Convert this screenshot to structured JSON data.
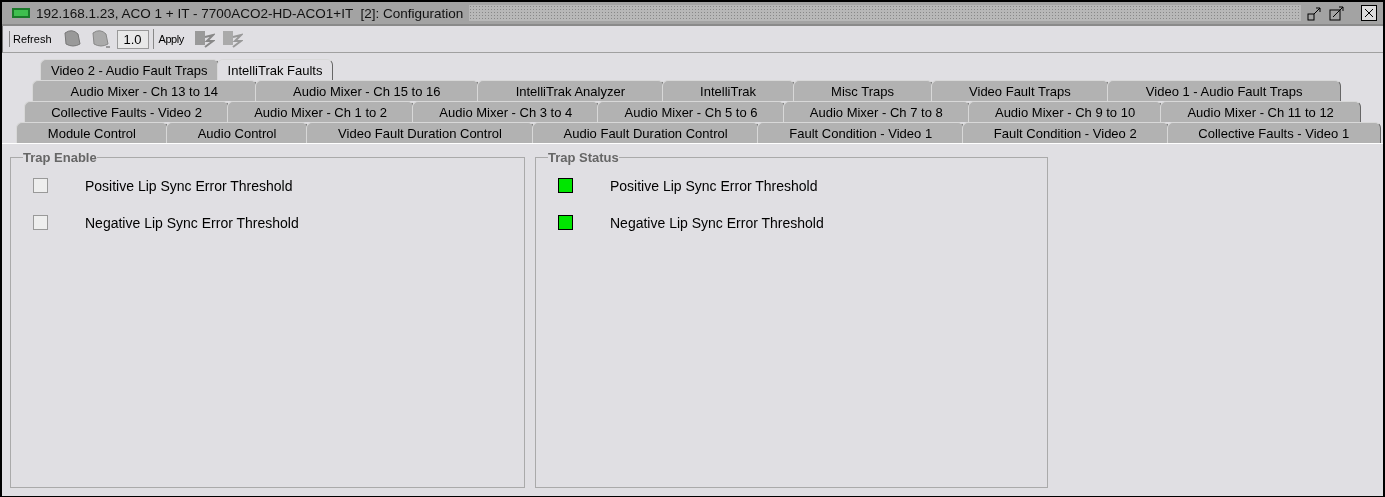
{
  "window": {
    "title": "192.168.1.23, ACO 1 + IT - 7700ACO2-HD-ACO1+IT  [2]: Configuration"
  },
  "toolbar": {
    "refresh": "Refresh",
    "value": "1.0",
    "apply": "Apply"
  },
  "tab_rows": [
    [
      {
        "label": "Video 2 - Audio Fault Traps",
        "selected": false
      },
      {
        "label": "IntelliTrak Faults",
        "selected": true
      }
    ],
    [
      {
        "label": "Audio Mixer - Ch 13 to 14",
        "selected": false
      },
      {
        "label": "Audio Mixer - Ch 15 to 16",
        "selected": false
      },
      {
        "label": "IntelliTrak Analyzer",
        "selected": false
      },
      {
        "label": "IntelliTrak",
        "selected": false
      },
      {
        "label": "Misc Traps",
        "selected": false
      },
      {
        "label": "Video Fault Traps",
        "selected": false
      },
      {
        "label": "Video 1 - Audio Fault Traps",
        "selected": false
      }
    ],
    [
      {
        "label": "Collective Faults - Video 2",
        "selected": false
      },
      {
        "label": "Audio Mixer - Ch 1 to 2",
        "selected": false
      },
      {
        "label": "Audio Mixer - Ch 3 to 4",
        "selected": false
      },
      {
        "label": "Audio Mixer - Ch 5 to 6",
        "selected": false
      },
      {
        "label": "Audio Mixer - Ch 7 to 8",
        "selected": false
      },
      {
        "label": "Audio Mixer - Ch 9 to 10",
        "selected": false
      },
      {
        "label": "Audio Mixer - Ch 11 to 12",
        "selected": false
      }
    ],
    [
      {
        "label": "Module Control",
        "selected": false
      },
      {
        "label": "Audio Control",
        "selected": false
      },
      {
        "label": "Video Fault Duration Control",
        "selected": false
      },
      {
        "label": "Audio Fault Duration Control",
        "selected": false
      },
      {
        "label": "Fault Condition - Video 1",
        "selected": false
      },
      {
        "label": "Fault Condition - Video 2",
        "selected": false
      },
      {
        "label": "Collective Faults - Video 1",
        "selected": false
      }
    ]
  ],
  "panels": [
    {
      "title": "Trap Enable",
      "kind": "checkbox",
      "items": [
        {
          "label": "Positive Lip Sync Error Threshold",
          "checked": false
        },
        {
          "label": "Negative Lip Sync Error Threshold",
          "checked": false
        }
      ]
    },
    {
      "title": "Trap Status",
      "kind": "status",
      "items": [
        {
          "label": "Positive Lip Sync Error Threshold",
          "color": "#00e600"
        },
        {
          "label": "Negative Lip Sync Error Threshold",
          "color": "#00e600"
        }
      ]
    }
  ]
}
